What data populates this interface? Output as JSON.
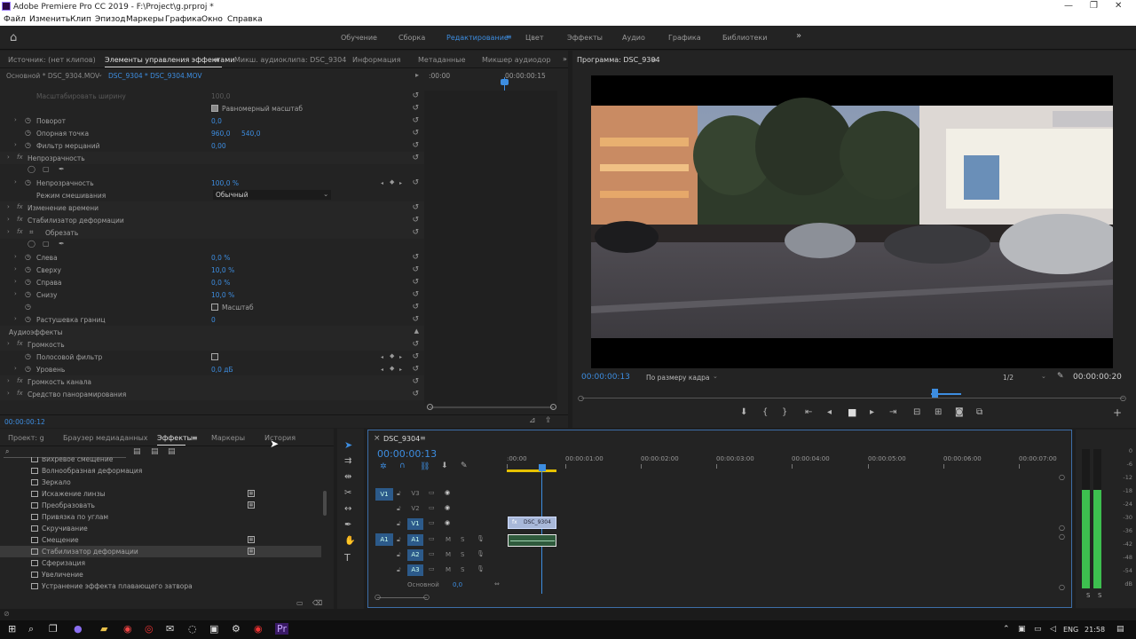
{
  "window": {
    "title": "Adobe Premiere Pro CC 2019 - F:\\Project\\g.prproj *",
    "controls": [
      "—",
      "❐",
      "✕"
    ]
  },
  "menu": [
    "Файл",
    "Изменить",
    "Клип",
    "Эпизод",
    "Маркеры",
    "Графика",
    "Окно",
    "Справка"
  ],
  "workspaces": [
    "Обучение",
    "Сборка",
    "Редактирование",
    "Цвет",
    "Эффекты",
    "Аудио",
    "Графика",
    "Библиотеки"
  ],
  "active_workspace": "Редактирование",
  "source_tabs": [
    "Источник: (нет клипов)",
    "Элементы управления эффектами",
    "Микш. аудиоклипа: DSC_9304",
    "Информация",
    "Метаданные",
    "Микшер аудиодор"
  ],
  "effect_controls": {
    "clip_path": "Основной * DSC_9304.MOV",
    "clip_target": "DSC_9304 * DSC_9304.MOV",
    "ruler_start": ":00:00",
    "ruler_mark": "00:00:00:15",
    "current_time": "00:00:00:12",
    "rows": [
      {
        "label": "Масштабировать ширину",
        "value": "100,0",
        "dim": true
      },
      {
        "label": "",
        "checkbox": true,
        "checked": true,
        "cb_label": "Равномерный масштаб"
      },
      {
        "label": "Поворот",
        "value": "0,0",
        "stopwatch": true,
        "chev": true
      },
      {
        "label": "Опорная точка",
        "value": "960,0",
        "value2": "540,0",
        "stopwatch": true
      },
      {
        "label": "Фильтр мерцаний",
        "value": "0,00",
        "stopwatch": true,
        "chev": true
      },
      {
        "label": "Непрозрачность",
        "fx": true,
        "section": true
      },
      {
        "label": "",
        "shapes": true
      },
      {
        "label": "Непрозрачность",
        "value": "100,0 %",
        "stopwatch": true,
        "chev": true,
        "keyframes": true
      },
      {
        "label": "Режим смешивания",
        "dropdown": "Обычный"
      },
      {
        "label": "Изменение времени",
        "fx": true,
        "section": true
      },
      {
        "label": "Стабилизатор деформации",
        "fx": true,
        "section": true
      },
      {
        "label": "Обрезать",
        "fx": true,
        "section": true,
        "crop": true
      },
      {
        "label": "",
        "shapes": true
      },
      {
        "label": "Слева",
        "value": "0,0 %",
        "stopwatch": true,
        "chev": true
      },
      {
        "label": "Сверху",
        "value": "10,0 %",
        "stopwatch": true,
        "chev": true
      },
      {
        "label": "Справа",
        "value": "0,0 %",
        "stopwatch": true,
        "chev": true
      },
      {
        "label": "Снизу",
        "value": "10,0 %",
        "stopwatch": true,
        "chev": true
      },
      {
        "label": "",
        "stopwatch": true,
        "checkbox": true,
        "checked": false,
        "cb_label": "Масштаб"
      },
      {
        "label": "Растушевка границ",
        "value": "0",
        "stopwatch": true,
        "chev": true
      },
      {
        "label": "Аудиоэффекты",
        "header": true
      },
      {
        "label": "Громкость",
        "fx": true,
        "section": true
      },
      {
        "label": "Полосовой фильтр",
        "stopwatch": true,
        "checkbox_value": true,
        "keyframes": true
      },
      {
        "label": "Уровень",
        "value": "0,0 дБ",
        "stopwatch": true,
        "chev": true,
        "keyframes": true
      },
      {
        "label": "Громкость канала",
        "fx": true,
        "section": true
      },
      {
        "label": "Средство панорамирования",
        "fx": true,
        "section": true
      }
    ]
  },
  "program": {
    "tab": "Программа: DSC_9304",
    "timecode": "00:00:00:13",
    "fit": "По размеру кадра",
    "resolution": "1/2",
    "duration": "00:00:00:20",
    "playhead_fraction": 0.65
  },
  "project_tabs": [
    "Проект: g",
    "Браузер медиаданных",
    "Эффекты",
    "Маркеры",
    "История"
  ],
  "active_project_tab": "Эффекты",
  "effects_list": [
    {
      "label": "Вихревое смещение",
      "badge": false
    },
    {
      "label": "Волнообразная деформация",
      "badge": false
    },
    {
      "label": "Зеркало",
      "badge": false
    },
    {
      "label": "Искажение линзы",
      "badge": true
    },
    {
      "label": "Преобразовать",
      "badge": true
    },
    {
      "label": "Привязка по углам",
      "badge": false
    },
    {
      "label": "Скручивание",
      "badge": false
    },
    {
      "label": "Смещение",
      "badge": true
    },
    {
      "label": "Стабилизатор деформации",
      "badge": true,
      "selected": true
    },
    {
      "label": "Сферизация",
      "badge": false
    },
    {
      "label": "Увеличение",
      "badge": false
    },
    {
      "label": "Устранение эффекта плавающего затвора",
      "badge": false
    }
  ],
  "timeline": {
    "tab": "DSC_9304",
    "timecode": "00:00:00:13",
    "ruler": [
      ":00:00",
      "00:00:01:00",
      "00:00:02:00",
      "00:00:03:00",
      "00:00:04:00",
      "00:00:05:00",
      "00:00:06:00",
      "00:00:07:00"
    ],
    "video_tracks": [
      "V3",
      "V2",
      "V1"
    ],
    "audio_tracks": [
      "A1",
      "A2",
      "A3"
    ],
    "source_v": "V1",
    "source_a": "A1",
    "master_label": "Основной",
    "master_value": "0,0",
    "clip_label": "DSC_9304",
    "track_btn_m": "M",
    "track_btn_s": "S"
  },
  "meter_labels": [
    "0",
    "-6",
    "-12",
    "-18",
    "-24",
    "-30",
    "-36",
    "-42",
    "-48",
    "-54",
    "dB"
  ],
  "meter_solo": [
    "S",
    "S"
  ],
  "taskbar": {
    "lang": "ENG",
    "time": "21:58"
  }
}
